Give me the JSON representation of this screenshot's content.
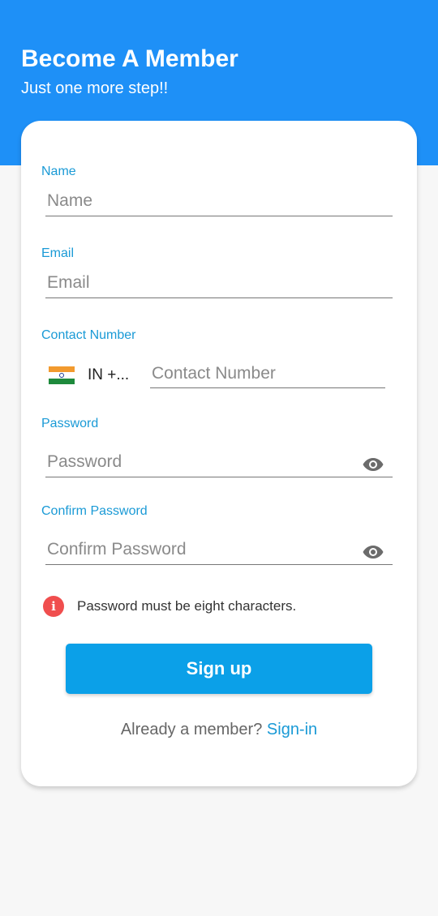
{
  "header": {
    "title": "Become A Member",
    "subtitle": "Just one more step!!"
  },
  "form": {
    "name": {
      "label": "Name",
      "placeholder": "Name",
      "value": ""
    },
    "email": {
      "label": "Email",
      "placeholder": "Email",
      "value": ""
    },
    "contact": {
      "label": "Contact Number",
      "country_code_display": "IN  +...",
      "flag_icon": "india-flag-icon",
      "placeholder": "Contact Number",
      "value": ""
    },
    "password": {
      "label": "Password",
      "placeholder": "Password",
      "value": "",
      "toggle_icon": "eye-icon"
    },
    "confirm_password": {
      "label": "Confirm Password",
      "placeholder": "Confirm Password",
      "value": "",
      "toggle_icon": "eye-icon"
    },
    "hint": {
      "icon": "info-icon",
      "text": "Password must be eight characters."
    },
    "signup_label": "Sign up",
    "signin_prompt": "Already a member?",
    "signin_link": "Sign-in"
  },
  "colors": {
    "header_bg": "#1e90f7",
    "accent": "#1a9ad6",
    "button_bg": "#0ba0e8",
    "error": "#f04e4e"
  }
}
